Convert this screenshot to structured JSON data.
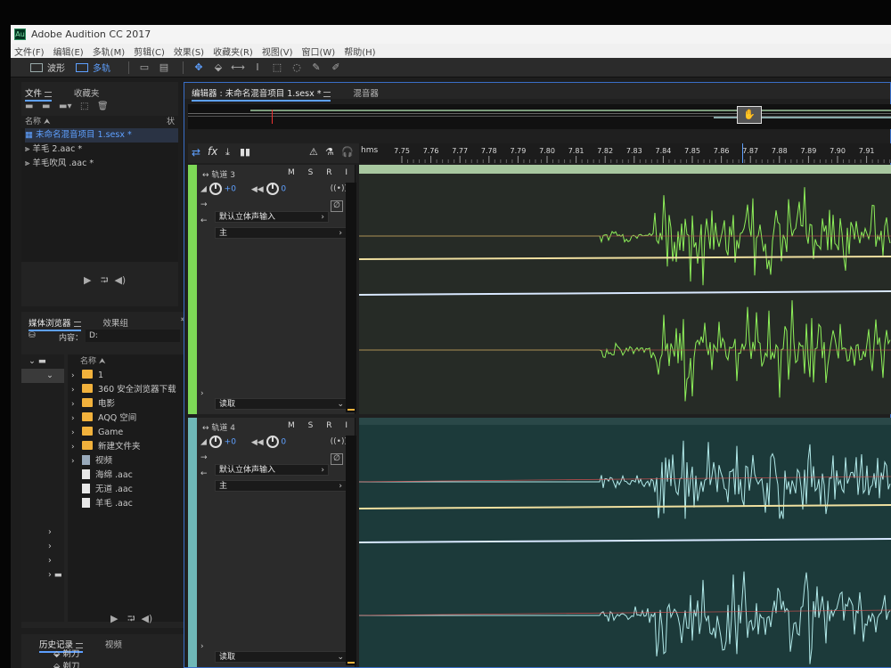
{
  "window": {
    "title": "Adobe Audition CC 2017"
  },
  "menu": [
    "文件(F)",
    "编辑(E)",
    "多轨(M)",
    "剪辑(C)",
    "效果(S)",
    "收藏夹(R)",
    "视图(V)",
    "窗口(W)",
    "帮助(H)"
  ],
  "toolbar": {
    "waveform_label": "波形",
    "multitrack_label": "多轨"
  },
  "files_panel": {
    "tabs": [
      "文件",
      "收藏夹"
    ],
    "col_name": "名称",
    "col_status": "状",
    "items": [
      "未命名混音项目 1.sesx *",
      "羊毛 2.aac *",
      "羊毛吹风 .aac *"
    ]
  },
  "media_panel": {
    "tabs": [
      "媒体浏览器",
      "效果组"
    ],
    "content_label": "内容：",
    "content_value": "D:",
    "col_name": "名称",
    "items": [
      {
        "name": "1",
        "type": "folder"
      },
      {
        "name": "360 安全浏览器下载",
        "type": "folder"
      },
      {
        "name": "电影",
        "type": "folder"
      },
      {
        "name": "AQQ 空间",
        "type": "folder"
      },
      {
        "name": "Game",
        "type": "folder"
      },
      {
        "name": "新建文件夹",
        "type": "folder"
      },
      {
        "name": "视频",
        "type": "video"
      },
      {
        "name": "海绵 .aac",
        "type": "file"
      },
      {
        "name": "无道 .aac",
        "type": "file"
      },
      {
        "name": "羊毛 .aac",
        "type": "file"
      }
    ]
  },
  "history_panel": {
    "tabs": [
      "历史记录",
      "视频"
    ],
    "items": [
      "剃刀",
      "剃刀"
    ]
  },
  "editor": {
    "tabs": [
      "编辑器 : 未命名混音项目 1.sesx *",
      "混音器"
    ],
    "ruler_unit": "hms",
    "ruler_ticks": [
      "7.75",
      "7.76",
      "7.77",
      "7.78",
      "7.79",
      "7.80",
      "7.81",
      "7.82",
      "7.83",
      "7.84",
      "7.85",
      "7.86",
      "7.87",
      "7.88",
      "7.89",
      "7.90",
      "7.91"
    ],
    "tracks": [
      {
        "name": "轨道 3",
        "volume": "+0",
        "pan": "0",
        "m": "M",
        "s": "S",
        "r": "R",
        "input": "默认立体声输入",
        "output": "主",
        "mode": "读取",
        "color": "#7ed957"
      },
      {
        "name": "轨道 4",
        "volume": "+0",
        "pan": "0",
        "m": "M",
        "s": "S",
        "r": "R",
        "input": "默认立体声输入",
        "output": "主",
        "mode": "读取",
        "color": "#6fb8b8"
      }
    ]
  }
}
